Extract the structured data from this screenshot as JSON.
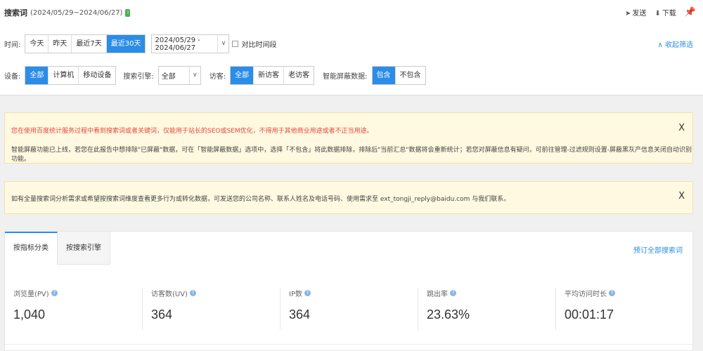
{
  "header": {
    "title": "搜索词",
    "range": "(2024/05/29~2024/06/27)",
    "actions": {
      "send": "发送",
      "download": "下载"
    },
    "collapse_filter": "∧ 收起筛选"
  },
  "filters": {
    "time": {
      "label": "时间:",
      "options": [
        "今天",
        "昨天",
        "最近7天",
        "最近30天"
      ],
      "selected": "最近30天",
      "date_range": "2024/05/29 - 2024/06/27",
      "compare_label": "对比时间段"
    },
    "device": {
      "label": "设备:",
      "options": [
        "全部",
        "计算机",
        "移动设备"
      ],
      "selected": "全部"
    },
    "search_engine": {
      "label": "搜索引擎:",
      "value": "全部"
    },
    "visitor": {
      "label": "访客:",
      "options": [
        "全部",
        "新访客",
        "老访客"
      ],
      "selected": "全部"
    },
    "smart_shield": {
      "label": "智能屏蔽数据:",
      "options": [
        "包含",
        "不包含"
      ],
      "selected": "包含"
    }
  },
  "notices": [
    {
      "red_text": "您在使用百度统计服务过程中看到搜索词或者关键词，仅能用于站长的SEO或SEM优化，不得用于其他商业用途或者不正当用途。",
      "grey_text": "智能屏蔽功能已上线，若您在此报告中想排除\"已屏蔽\"数据，可在「智能屏蔽数据」选项中，选择「不包含」将此数据排除，排除后\"当前汇总\"数据将会重新统计；若您对屏蔽信息有疑问，可前往管理-过滤规则设置-屏蔽黑灰产信息关闭自动识别功能。",
      "close": "X"
    },
    {
      "grey_text": "如有全量搜索词分析需求或希望按搜索词维度查看更多行为或转化数据，可发送您的公司名称、联系人姓名及电话号码、使用需求至 ext_tongji_reply@baidu.com 与我们联系。",
      "close": "X"
    }
  ],
  "card": {
    "tabs": [
      "按指标分类",
      "按搜索引擎"
    ],
    "active_tab": "按指标分类",
    "subscribe": "预订全部搜索词",
    "metrics": [
      {
        "label": "浏览量(PV)",
        "value": "1,040"
      },
      {
        "label": "访客数(UV)",
        "value": "364"
      },
      {
        "label": "IP数",
        "value": "364"
      },
      {
        "label": "跳出率",
        "value": "23.63%"
      },
      {
        "label": "平均访问时长",
        "value": "00:01:17"
      }
    ]
  },
  "icons": {
    "help": "question-icon",
    "send": "send-icon",
    "download": "download-icon",
    "pin": "pin-icon"
  },
  "colors": {
    "accent": "#2b8de7",
    "warning_red": "#e8463c",
    "notice_bg": "#fef9e0"
  }
}
